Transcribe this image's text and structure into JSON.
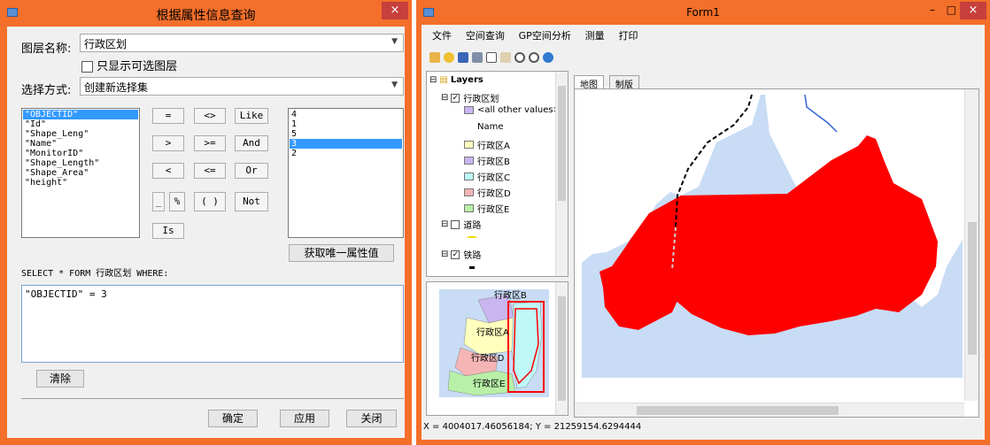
{
  "dialog": {
    "title": "根据属性信息查询",
    "close_glyph": "×",
    "layer_label": "图层名称:",
    "layer_value": "行政区划",
    "only_selectable_label": "只显示可选图层",
    "method_label": "选择方式:",
    "method_value": "创建新选择集",
    "fields": [
      "\"OBJECTID\"",
      "\"Id\"",
      "\"Shape_Leng\"",
      "\"Name\"",
      "\"MonitorID\"",
      "\"Shape_Length\"",
      "\"Shape_Area\"",
      "\"height\""
    ],
    "operators": {
      "eq": "=",
      "ne": "<>",
      "like": "Like",
      "gt": ">",
      "ge": ">=",
      "and": "And",
      "lt": "<",
      "le": "<=",
      "or": "Or",
      "underscore": "_",
      "percent": "%",
      "parens": "( )",
      "not": "Not",
      "is": "Is"
    },
    "values": [
      "4",
      "1",
      "5",
      "3",
      "2"
    ],
    "selected_value_index": 3,
    "get_unique_button": "获取唯一属性值",
    "sql_prefix": "SELECT * FORM  行政区划 WHERE:",
    "sql_text": "\"OBJECTID\" = 3",
    "clear_button": "清除",
    "ok_button": "确定",
    "apply_button": "应用",
    "cancel_button": "关闭"
  },
  "form1": {
    "title": "Form1",
    "minimize_glyph": "–",
    "maximize_glyph": "□",
    "close_glyph": "×",
    "menu": [
      "文件",
      "空间查询",
      "GP空间分析",
      "测量",
      "打印"
    ],
    "toolbar_icons": [
      "open-icon",
      "add-data-icon",
      "save-icon",
      "layer-icon",
      "select-icon",
      "pan-icon",
      "zoom-in-icon",
      "zoom-out-icon",
      "globe-icon"
    ],
    "toc": {
      "root": "Layers",
      "layer1": "行政区划",
      "other_values": "<all other values>",
      "name_field": "Name",
      "classes": [
        {
          "label": "行政区A",
          "color": "#ffffbe"
        },
        {
          "label": "行政区B",
          "color": "#c9b5f0"
        },
        {
          "label": "行政区C",
          "color": "#bef8f8"
        },
        {
          "label": "行政区D",
          "color": "#f5b5b5"
        },
        {
          "label": "行政区E",
          "color": "#b8f0a8"
        }
      ],
      "layer2": "道路",
      "layer3": "铁路"
    },
    "tabs": [
      "地图",
      "制版"
    ],
    "overview_labels": [
      "行政区B",
      "行政区A",
      "行政区D",
      "行政区E"
    ],
    "status_text": "X = 4004017.46056184;  Y = 21259154.6294444",
    "colors": {
      "selection": "#ff0000",
      "water": "#c8dcf5",
      "frame": "#f36f2a"
    }
  }
}
